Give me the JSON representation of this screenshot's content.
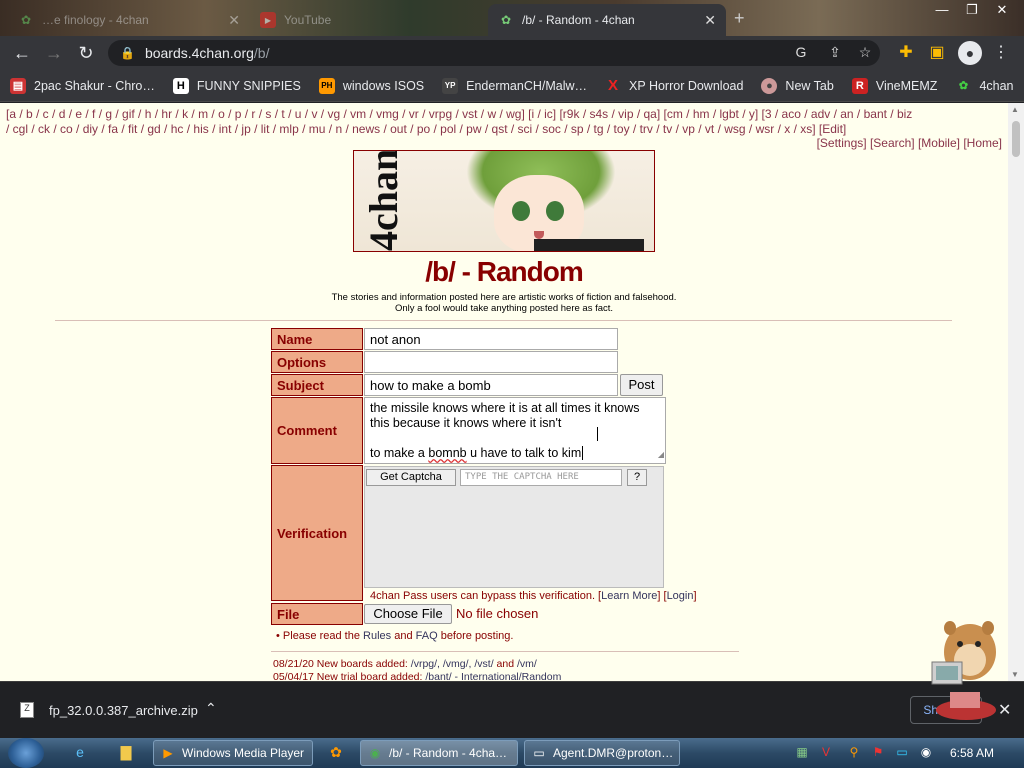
{
  "browser": {
    "tabs": [
      {
        "title": "…e finology - 4chan",
        "icon": "4chan-clover-icon"
      },
      {
        "title": "YouTube",
        "icon": "youtube-icon"
      },
      {
        "title": "/b/ - Random - 4chan",
        "icon": "4chan-clover-icon"
      }
    ],
    "url_host": "boards.4chan.org",
    "url_path": "/b/",
    "bookmarks": [
      {
        "label": "2pac Shakur - Chro…",
        "icon": "page-icon",
        "color": "#d33"
      },
      {
        "label": "FUNNY SNIPPIES",
        "icon": "h-icon",
        "glyph": "H",
        "color": "#fff"
      },
      {
        "label": "windows ISOS",
        "icon": "ph-icon",
        "glyph": "PH",
        "color": "#f90"
      },
      {
        "label": "EndermanCH/Malw…",
        "icon": "yp-icon",
        "glyph": "YP",
        "color": "#555"
      },
      {
        "label": "XP Horror Download",
        "icon": "x-icon",
        "glyph": "X",
        "color": "#e22"
      },
      {
        "label": "New Tab",
        "icon": "avatar-icon",
        "glyph": "●",
        "color": "#c99"
      },
      {
        "label": "VineMEMZ",
        "icon": "r-icon",
        "glyph": "R",
        "color": "#c22"
      },
      {
        "label": "4chan",
        "icon": "4chan-clover-icon",
        "glyph": "☘",
        "color": "#2a2"
      }
    ]
  },
  "page": {
    "boardlist_line1": "[a / b / c / d / e / f / g / gif / h / hr / k / m / o / p / r / s / t / u / v / vg / vm / vmg / vr / vrpg / vst / w / wg] [i / ic] [r9k / s4s / vip / qa] [cm / hm / lgbt / y] [3 / aco / adv / an / bant / biz",
    "boardlist_line2": "/ cgl / ck / co / diy / fa / fit / gd / hc / his / int / jp / lit / mlp / mu / n / news / out / po / pol / pw / qst / sci / soc / sp / tg / toy / trv / tv / vp / vt / wsg / wsr / x / xs] [Edit]",
    "boardlist_right": "[Settings] [Search] [Mobile] [Home]",
    "banner_logo": "4chan",
    "board_title": "/b/ - Random",
    "board_sub1": "The stories and information posted here are artistic works of fiction and falsehood.",
    "board_sub2": "Only a fool would take anything posted here as fact.",
    "form": {
      "name_label": "Name",
      "name_value": "not anon",
      "options_label": "Options",
      "options_value": "",
      "subject_label": "Subject",
      "subject_value": "how to make a bomb",
      "post_button": "Post",
      "comment_label": "Comment",
      "comment_line1": "the missile knows where it is at all times it knows",
      "comment_line2": "this because it knows where it isn't",
      "comment_line3_pre": "to make a ",
      "comment_line3_misspelled": "bomnb",
      "comment_line3_post": " u have to talk to kim",
      "verification_label": "Verification",
      "get_captcha": "Get Captcha",
      "captcha_placeholder": "TYPE THE CAPTCHA HERE",
      "captcha_help": "?",
      "pass_note_pre": "4chan Pass users can bypass this verification. [",
      "learn_more": "Learn More",
      "pass_note_mid": "] [",
      "login": "Login",
      "pass_note_post": "]",
      "file_label": "File",
      "choose_file": "Choose File",
      "no_file": "No file chosen"
    },
    "rules_pre": "• Please read the ",
    "rules_link": "Rules",
    "rules_and": " and ",
    "faq_link": "FAQ",
    "rules_post": " before posting.",
    "news": [
      {
        "date": "08/21/20",
        "text_pre": " New boards added: ",
        "links": "/vrpg/, /vmg/, /vst/",
        "and": " and ",
        "last": "/vm/"
      },
      {
        "date": "05/04/17",
        "text_pre": " New trial board added: ",
        "links": "/bant/ - International/Random",
        "and": "",
        "last": ""
      }
    ]
  },
  "downloads": {
    "filename": "fp_32.0.0.387_archive.zip",
    "show_all": "Show all"
  },
  "taskbar": {
    "items": [
      {
        "label": "Windows Media Player",
        "icon": "media-player-icon"
      },
      {
        "label": "/b/ - Random - 4cha…",
        "icon": "chrome-icon"
      },
      {
        "label": "Agent.DMR@proton…",
        "icon": "window-icon"
      }
    ],
    "clock": "6:58 AM"
  }
}
